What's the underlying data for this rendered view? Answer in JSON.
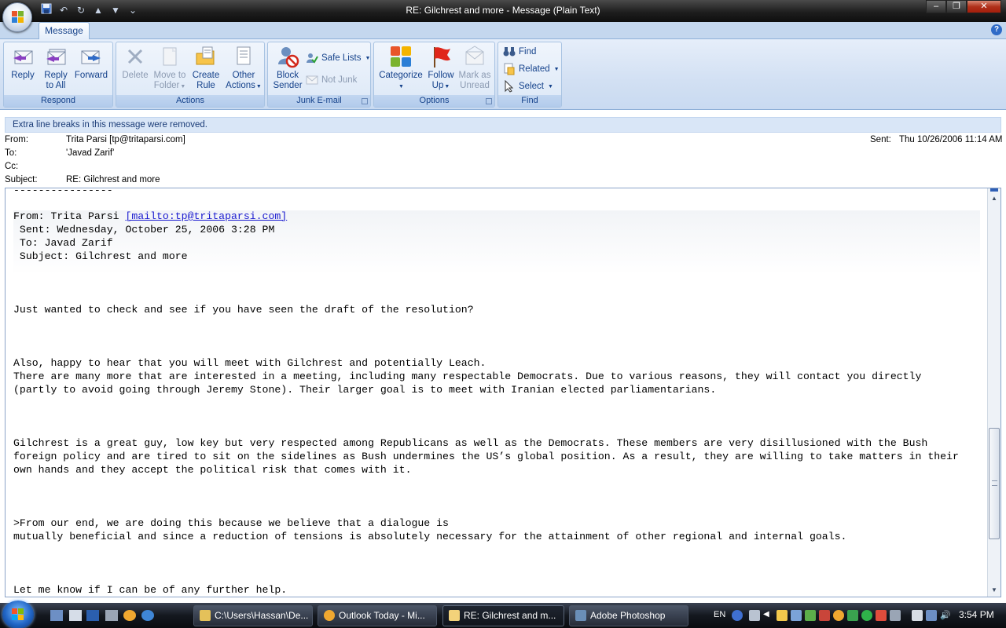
{
  "window": {
    "title": "RE: Gilchrest and more - Message (Plain Text)"
  },
  "quick_access": [
    "save-icon",
    "undo-icon",
    "redo-icon",
    "up-arrow-icon",
    "down-arrow-icon",
    "customize-icon"
  ],
  "ribbon": {
    "active_tab": "Message",
    "groups": {
      "respond": {
        "label": "Respond",
        "reply": "Reply",
        "reply_all_1": "Reply",
        "reply_all_2": "to All",
        "forward": "Forward"
      },
      "actions": {
        "label": "Actions",
        "delete": "Delete",
        "move_1": "Move to",
        "move_2": "Folder",
        "create_1": "Create",
        "create_2": "Rule",
        "other_1": "Other",
        "other_2": "Actions"
      },
      "junk": {
        "label": "Junk E-mail",
        "block_1": "Block",
        "block_2": "Sender",
        "safe_lists": "Safe Lists",
        "not_junk": "Not Junk"
      },
      "options": {
        "label": "Options",
        "categorize": "Categorize",
        "follow_1": "Follow",
        "follow_2": "Up",
        "mark_1": "Mark as",
        "mark_2": "Unread"
      },
      "find": {
        "label": "Find",
        "find": "Find",
        "related": "Related",
        "select": "Select"
      }
    }
  },
  "infobar": {
    "text": "Extra line breaks in this message were removed."
  },
  "header": {
    "from_label": "From:",
    "from_value": "Trita Parsi [tp@tritaparsi.com]",
    "to_label": "To:",
    "to_value": "'Javad Zarif'",
    "cc_label": "Cc:",
    "cc_value": "",
    "subject_label": "Subject:",
    "subject_value": "RE: Gilchrest and more",
    "sent_label": "Sent:",
    "sent_value": "Thu 10/26/2006 11:14 AM"
  },
  "body": {
    "separator": "----------------",
    "quoted_from_prefix": "From: Trita Parsi ",
    "quoted_from_link": "[mailto:tp@tritaparsi.com]",
    "quoted_sent": " Sent: Wednesday, October 25, 2006 3:28 PM",
    "quoted_to": " To: Javad Zarif",
    "quoted_subject": " Subject: Gilchrest and more",
    "para1": "Just wanted to check and see if you have seen the draft of the resolution?",
    "para2_l1": "Also, happy to hear that you will meet with Gilchrest and potentially Leach.",
    "para2_l2": "There are many more that are interested in a meeting, including many respectable Democrats. Due to various reasons, they will contact you directly",
    "para2_l3": "(partly to avoid going through Jeremy Stone). Their larger goal is to meet with Iranian elected parliamentarians.",
    "para3_l1": "Gilchrest is a great guy, low key but very respected among Republicans as well as the Democrats. These members are very disillusioned with the Bush",
    "para3_l2": "foreign policy and are tired to sit on the sidelines as Bush undermines the US’s global position. As a result, they are willing to take matters in their",
    "para3_l3": "own hands and they accept the political risk that comes with it.",
    "para4_l1": ">From our end, we are doing this because we believe that a dialogue is",
    "para4_l2": "mutually beneficial and since a reduction of tensions is absolutely necessary for the attainment of other regional and internal goals.",
    "para5": "Let me know if I can be of any further help."
  },
  "taskbar": {
    "items": [
      {
        "label": "C:\\Users\\Hassan\\De...",
        "icon": "folder-icon"
      },
      {
        "label": "Outlook Today - Mi...",
        "icon": "outlook-icon"
      },
      {
        "label": "RE: Gilchrest and m...",
        "icon": "mail-icon"
      },
      {
        "label": "Adobe Photoshop",
        "icon": "photoshop-icon"
      }
    ],
    "language": "EN",
    "clock": "3:54 PM"
  }
}
